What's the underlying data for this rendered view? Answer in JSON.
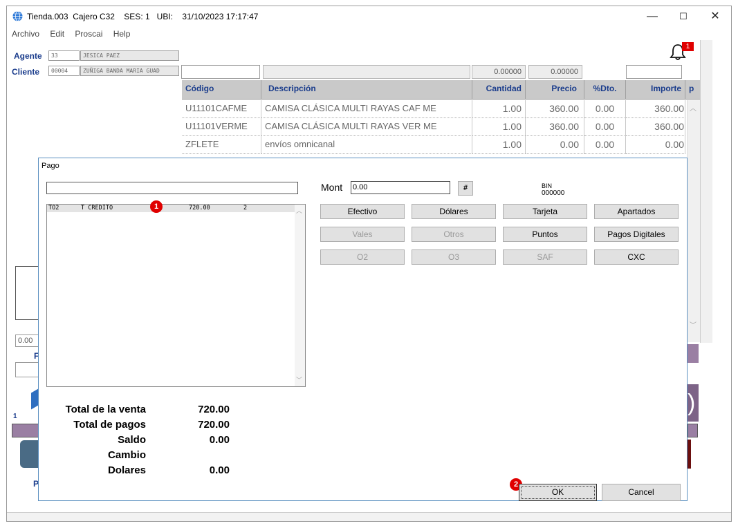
{
  "window": {
    "title": "Tienda.003  Cajero C32    SES: 1   UBI:    31/10/2023 17:17:47",
    "minimize_glyph": "—",
    "maximize_glyph": "☐",
    "close_glyph": "✕"
  },
  "menu": {
    "items": [
      "Archivo",
      "Edit",
      "Proscai",
      "Help"
    ]
  },
  "notification": {
    "count": "1"
  },
  "agent": {
    "label": "Agente",
    "code": "33",
    "name": "JESICA PAEZ"
  },
  "client": {
    "label": "Cliente",
    "code": "00004",
    "name": "ZUÑIGA BANDA MARIA GUAD"
  },
  "toolbar": {
    "num1": "0.00000",
    "num2": "0.00000"
  },
  "grid": {
    "headers": [
      "Código",
      "Descripción",
      "Cantidad",
      "Precio",
      "%Dto.",
      "Importe",
      "p"
    ],
    "rows": [
      {
        "codigo": "U11101CAFME",
        "descripcion": "CAMISA CLÁSICA MULTI RAYAS CAF ME",
        "cantidad": "1.00",
        "precio": "360.00",
        "dto": "0.00",
        "importe": "360.00"
      },
      {
        "codigo": "U11101VERME",
        "descripcion": "CAMISA CLÁSICA MULTI RAYAS VER ME",
        "cantidad": "1.00",
        "precio": "360.00",
        "dto": "0.00",
        "importe": "360.00"
      },
      {
        "codigo": "ZFLETE",
        "descripcion": "envíos omnicanal",
        "cantidad": "1.00",
        "precio": "0.00",
        "dto": "0.00",
        "importe": "0.00"
      }
    ]
  },
  "background_fragments": {
    "left_value": "0.00",
    "left_label_1": "F",
    "left_label_2": "1",
    "left_label_3": "P",
    "right_digit": ")"
  },
  "dialog": {
    "title": "Pago",
    "mont_label": "Mont",
    "mont_value": "0.00",
    "hash_button": "#",
    "bin_label": "BIN",
    "bin_value": "000000",
    "payments": [
      {
        "code": "TO2",
        "type": "T CREDITO",
        "amount": "720.00",
        "n": "2"
      }
    ],
    "buttons": {
      "efectivo": "Efectivo",
      "dolares": "Dólares",
      "tarjeta": "Tarjeta",
      "apartados": "Apartados",
      "vales": "Vales",
      "otros": "Otros",
      "puntos": "Puntos",
      "pagos_digitales": "Pagos Digitales",
      "o2": "O2",
      "o3": "O3",
      "saf": "SAF",
      "cxc": "CXC",
      "ok": "OK",
      "cancel": "Cancel"
    },
    "totals": {
      "total_venta_label": "Total de la venta",
      "total_venta": "720.00",
      "total_pagos_label": "Total de pagos",
      "total_pagos": "720.00",
      "saldo_label": "Saldo",
      "saldo": "0.00",
      "cambio_label": "Cambio",
      "cambio": "",
      "dolares_label": "Dolares",
      "dolares": "0.00"
    }
  },
  "annotations": {
    "marker1": "1",
    "marker2": "2"
  },
  "colors": {
    "accent_blue": "#1a3c8c",
    "purple_bar": "#9a7fa3",
    "badge_red": "#e00000",
    "dialog_border": "#5a8fc0"
  }
}
